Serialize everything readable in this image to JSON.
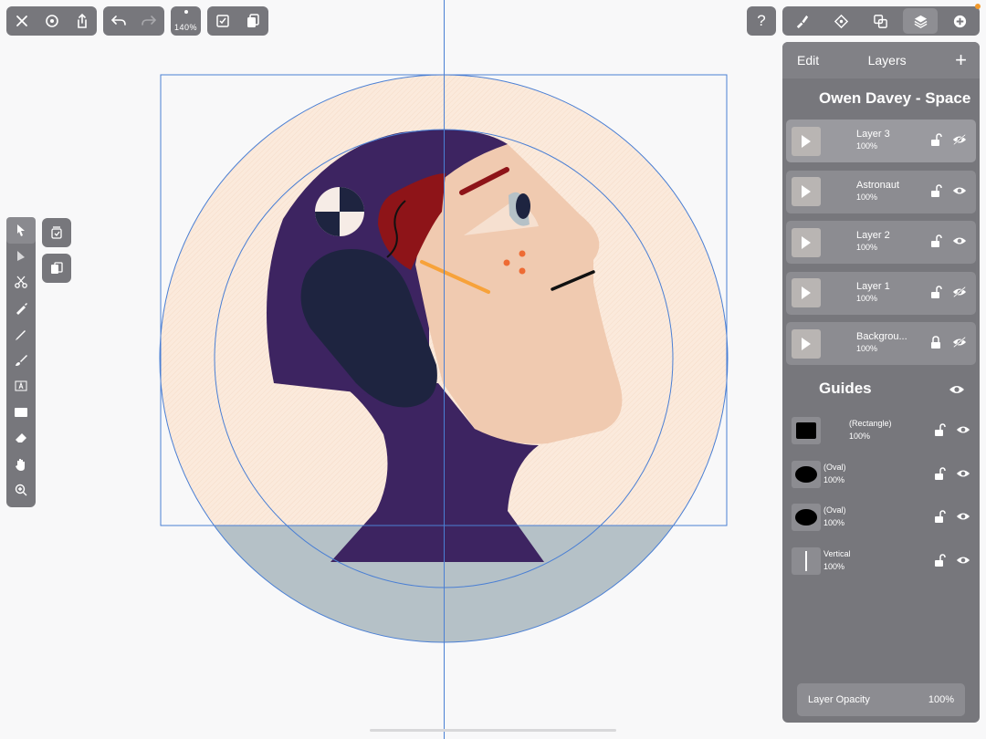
{
  "toolbar": {
    "zoom": "140%"
  },
  "panel": {
    "edit_label": "Edit",
    "title": "Layers",
    "document_title": "Owen Davey - Space",
    "layers": [
      {
        "name": "Layer 3",
        "opacity": "100%",
        "locked": false,
        "visible": false,
        "selected": true
      },
      {
        "name": "Astronaut",
        "opacity": "100%",
        "locked": false,
        "visible": true,
        "selected": false
      },
      {
        "name": "Layer 2",
        "opacity": "100%",
        "locked": false,
        "visible": true,
        "selected": false
      },
      {
        "name": "Layer 1",
        "opacity": "100%",
        "locked": false,
        "visible": false,
        "selected": false
      },
      {
        "name": "Backgrou...",
        "opacity": "100%",
        "locked": true,
        "visible": false,
        "selected": false
      }
    ],
    "guides_title": "Guides",
    "guides": [
      {
        "name": "(Rectangle)",
        "opacity": "100%",
        "shape": "rectangle"
      },
      {
        "name": "(Oval)",
        "opacity": "100%",
        "shape": "oval"
      },
      {
        "name": "(Oval)",
        "opacity": "100%",
        "shape": "oval"
      },
      {
        "name": "Vertical",
        "opacity": "100%",
        "shape": "vertical"
      }
    ],
    "layer_opacity_label": "Layer Opacity",
    "layer_opacity_value": "100%"
  },
  "colors": {
    "ui_gray": "#77777c",
    "canvas_bg": "#f8f8f9",
    "cream": "#fbeadc",
    "purple": "#3d2461",
    "navy": "#1e2440",
    "skin": "#f0cab0",
    "maroon": "#8e1418",
    "orange": "#f7a23a",
    "freckle": "#ee6b34",
    "sea": "#b5c1c7",
    "guide_blue": "#4a7fd4"
  }
}
